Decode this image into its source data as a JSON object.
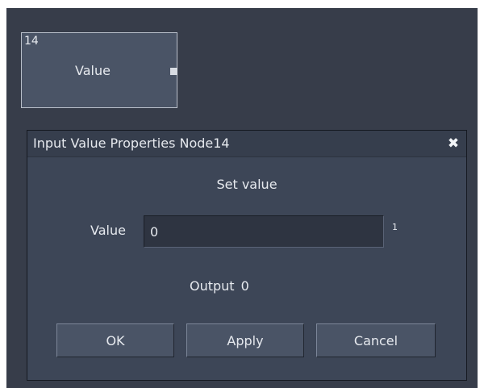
{
  "node": {
    "id": "14",
    "label": "Value"
  },
  "dialog": {
    "title": "Input Value Properties Node14",
    "close_glyph": "✖",
    "section_title": "Set value",
    "value_label": "Value",
    "value": "0",
    "value_suffix": "1",
    "output_label": "Output",
    "output_value": "0",
    "buttons": {
      "ok": "OK",
      "apply": "Apply",
      "cancel": "Cancel"
    }
  },
  "colors": {
    "canvas_background": "#373d4a",
    "dialog_background": "#3d4657",
    "node_background": "#4a5466",
    "text": "#e6e9ee"
  },
  "icons": {
    "close": "close-icon",
    "node_output_port": "output-port-icon"
  }
}
